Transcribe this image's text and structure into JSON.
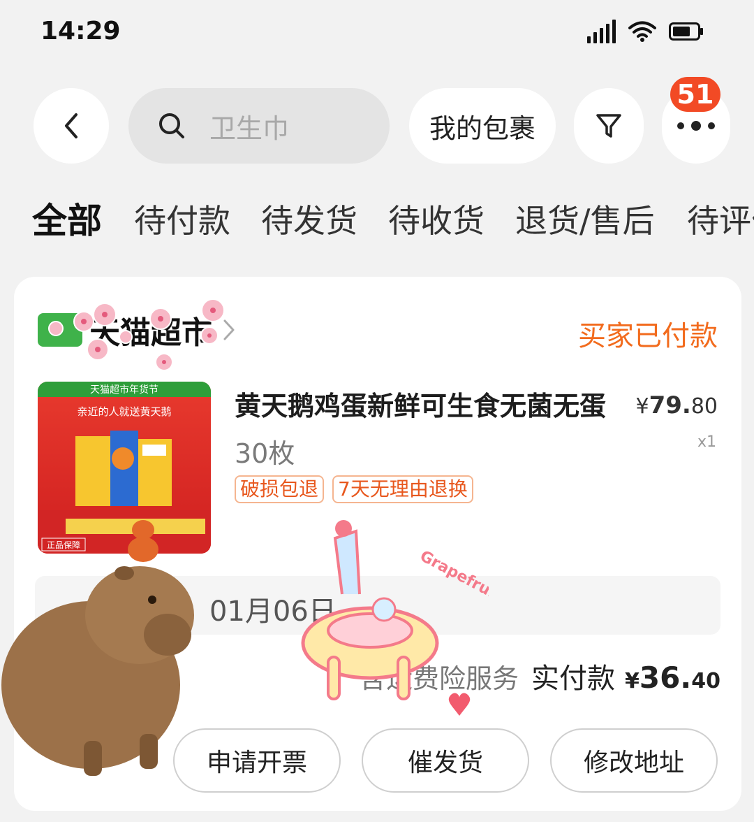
{
  "status_bar": {
    "time": "14:29"
  },
  "top_bar": {
    "search_placeholder": "卫生巾",
    "parcel_label": "我的包裹",
    "more_badge": "51"
  },
  "tabs": [
    {
      "label": "全部",
      "active": true
    },
    {
      "label": "待付款"
    },
    {
      "label": "待发货"
    },
    {
      "label": "待收货"
    },
    {
      "label": "退货/售后"
    },
    {
      "label": "待评价"
    }
  ],
  "order": {
    "shop_name": "天猫超市",
    "status": "买家已付款",
    "product": {
      "title": "黄天鹅鸡蛋新鲜可生食无菌无蛋",
      "subtitle": "30枚",
      "price_symbol": "¥",
      "price_int": "79.",
      "price_dec": "80",
      "quantity": "x1",
      "image_banner": "天猫超市年货节",
      "image_slogan": "亲近的人就送黄天鹅",
      "image_badge": "正品保障",
      "tags": [
        "破损包退",
        "7天无理由退换"
      ]
    },
    "shipping_text": "01月06日",
    "service_text": "含运费险服务",
    "paid_label": "实付款",
    "paid_symbol": "¥",
    "paid_int": "36.",
    "paid_dec": "40",
    "actions": [
      "申请开票",
      "催发货",
      "修改地址"
    ]
  },
  "sticker": {
    "text": "Grapefruit"
  },
  "colors": {
    "accent": "#f26b1d",
    "badge": "#f24a25",
    "shop_green": "#3fb24a"
  }
}
